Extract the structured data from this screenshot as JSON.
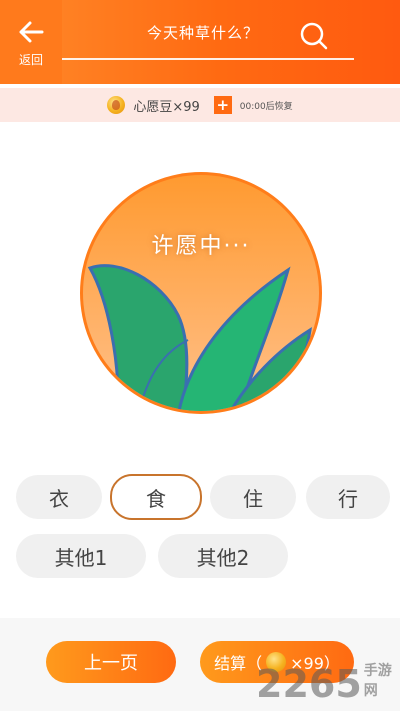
{
  "header": {
    "back_label": "返回",
    "title": "今天种草什么？"
  },
  "status": {
    "beans_label": "心愿豆×99",
    "plus_label": "+",
    "timer_text": "00:00后恢复"
  },
  "wish": {
    "text": "许愿中···"
  },
  "categories": [
    "衣",
    "食",
    "住",
    "行",
    "其他1",
    "其他2"
  ],
  "selected_category": "食",
  "footer": {
    "prev_label": "上一页",
    "settle_label": "结算（",
    "settle_count": "×99）"
  },
  "watermark": {
    "number": "2265",
    "text": "手游网"
  },
  "colors": {
    "accent": "#ff6a12",
    "status_bg": "#fde8e3",
    "chip_bg": "#f0f0f0",
    "selected_border": "#c8742c",
    "leaf": "#2aa56d"
  }
}
